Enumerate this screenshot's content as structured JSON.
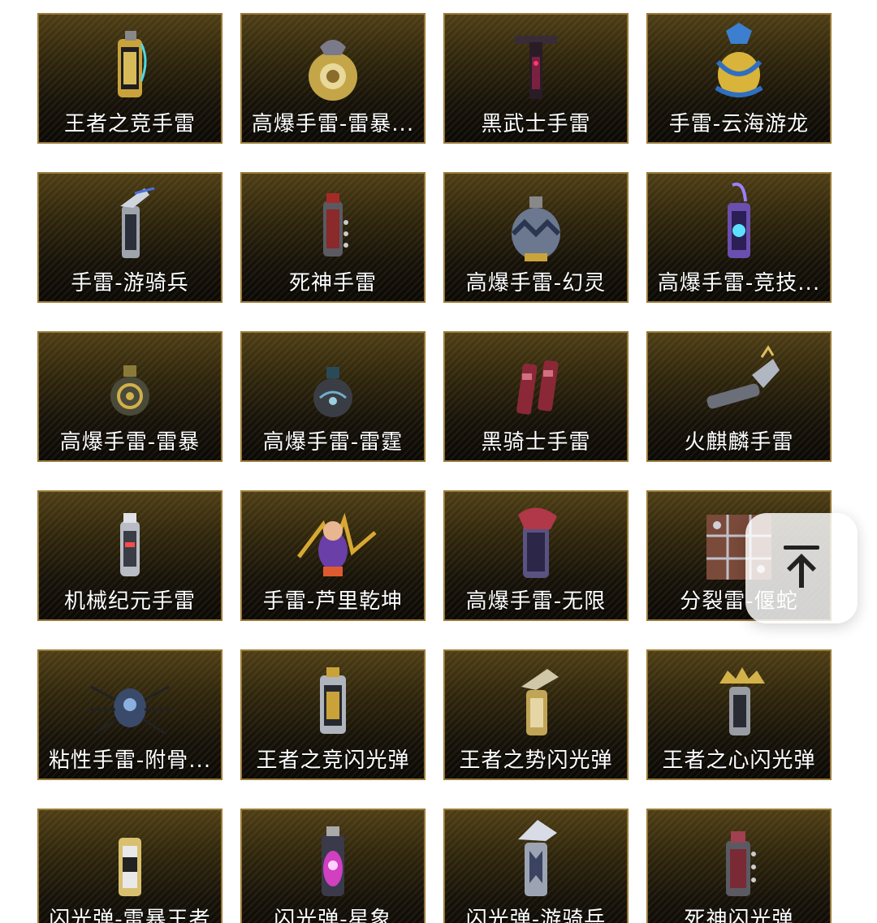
{
  "items": [
    {
      "name": "王者之竞手雷",
      "icon": "gold-canister-grenade-icon"
    },
    {
      "name": "高爆手雷-雷暴...",
      "icon": "gold-round-grenade-icon"
    },
    {
      "name": "黑武士手雷",
      "icon": "dark-stick-grenade-icon"
    },
    {
      "name": "手雷-云海游龙",
      "icon": "dragon-ornate-grenade-icon"
    },
    {
      "name": "手雷-游骑兵",
      "icon": "silver-winged-canister-icon"
    },
    {
      "name": "死神手雷",
      "icon": "red-canister-grenade-icon"
    },
    {
      "name": "高爆手雷-幻灵",
      "icon": "blue-round-grenade-icon"
    },
    {
      "name": "高爆手雷-竞技...",
      "icon": "purple-canister-grenade-icon"
    },
    {
      "name": "高爆手雷-雷暴",
      "icon": "gold-ring-round-grenade-icon"
    },
    {
      "name": "高爆手雷-雷霆",
      "icon": "dark-round-grenade-icon"
    },
    {
      "name": "黑骑士手雷",
      "icon": "twin-red-canister-icon"
    },
    {
      "name": "火麒麟手雷",
      "icon": "qilin-stick-grenade-icon"
    },
    {
      "name": "机械纪元手雷",
      "icon": "mech-canister-grenade-icon"
    },
    {
      "name": "手雷-芦里乾坤",
      "icon": "gourd-character-icon"
    },
    {
      "name": "高爆手雷-无限",
      "icon": "purple-red-canister-icon"
    },
    {
      "name": "分裂雷-偃蛇",
      "icon": "box-cluster-grenade-icon"
    },
    {
      "name": "粘性手雷-附骨...",
      "icon": "spider-sticky-grenade-icon"
    },
    {
      "name": "王者之竞闪光弹",
      "icon": "gold-flash-canister-icon"
    },
    {
      "name": "王者之势闪光弹",
      "icon": "gold-winged-flash-icon"
    },
    {
      "name": "王者之心闪光弹",
      "icon": "gold-crown-flash-icon"
    },
    {
      "name": "闪光弹-雷暴王者",
      "icon": "gold-white-flash-icon"
    },
    {
      "name": "闪光弹-星象",
      "icon": "pink-galaxy-flash-icon"
    },
    {
      "name": "闪光弹-游骑兵",
      "icon": "silver-winged-flash-icon"
    },
    {
      "name": "死神闪光弹",
      "icon": "red-spike-flash-icon"
    }
  ],
  "scroll_top": {
    "icon": "arrow-up-to-top-icon"
  },
  "colors": {
    "card_border": "#9a7a38",
    "card_top": "#4e3e16",
    "card_bottom": "#0b0906",
    "label_text": "#ffffff",
    "page_background": "#ffffff"
  }
}
